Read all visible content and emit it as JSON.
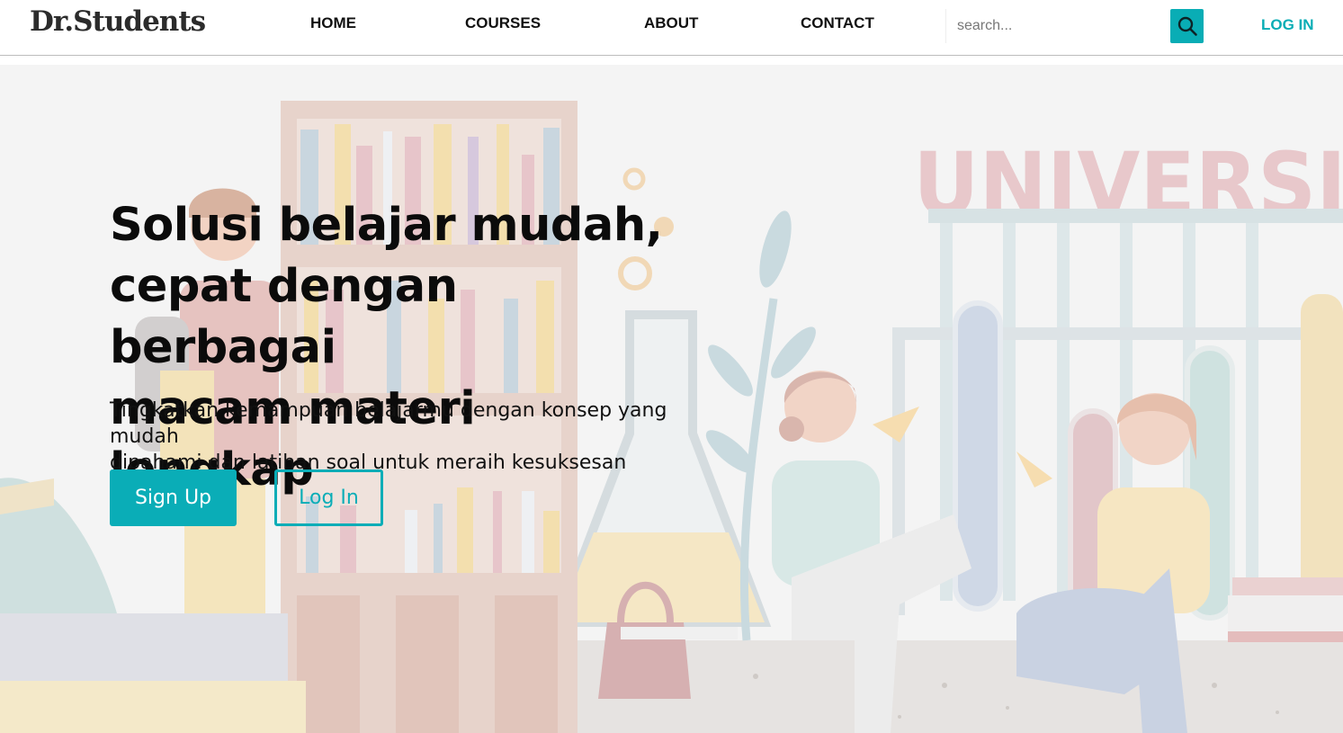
{
  "brand": {
    "logo_text": "Dr.Students"
  },
  "nav": {
    "items": [
      {
        "label": "HOME"
      },
      {
        "label": "COURSES"
      },
      {
        "label": "ABOUT"
      },
      {
        "label": "CONTACT"
      }
    ],
    "search_placeholder": "search...",
    "search_icon": "search-icon",
    "login_label": "LOG IN"
  },
  "hero": {
    "title_lines": [
      "Solusi belajar mudah,",
      "cepat dengan berbagai",
      "macam materi lengkap"
    ],
    "subtitle_lines": [
      "Tingkatkan kemampuan belajarmu dengan konsep yang mudah",
      "dipahami dan latihan soal untuk meraih kesuksesan"
    ],
    "signup_label": "Sign Up",
    "login_label": "Log In",
    "illustration_sign": "UNIVERSITY"
  },
  "colors": {
    "accent": "#0aadb7",
    "text": "#0b0b0b",
    "hero_bg": "#f4f4f4"
  }
}
